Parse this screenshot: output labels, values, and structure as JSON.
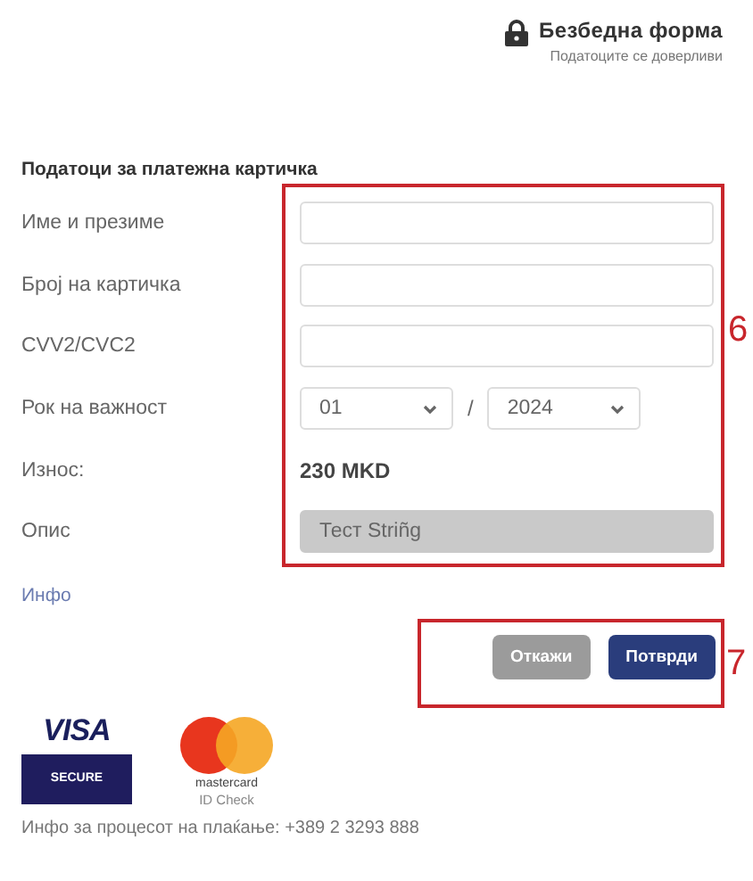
{
  "header": {
    "title": "Безбедна форма",
    "subtitle": "Податоците се доверливи"
  },
  "section_title": "Податоци за платежна картичка",
  "rows": [
    {
      "label": "Име и презиме",
      "kind": "input",
      "value": "",
      "disabled": false
    },
    {
      "label": "Број на картичка",
      "kind": "input",
      "value": "",
      "disabled": false
    },
    {
      "label": "CVV2/CVC2",
      "kind": "input",
      "value": "",
      "disabled": false
    },
    {
      "label": "Рок на важност",
      "kind": "expiry",
      "month": "01",
      "separator": "/",
      "year": "2024"
    },
    {
      "label": "Износ:",
      "kind": "amount",
      "value": "230 MKD"
    },
    {
      "label": "Опис",
      "kind": "input",
      "value": "Тест Striñg",
      "disabled": true
    }
  ],
  "info_link": "Инфо",
  "buttons": [
    {
      "label": "Откажи",
      "kind": "secondary"
    },
    {
      "label": "Потврди",
      "kind": "primary"
    }
  ],
  "logos": {
    "visa": {
      "brand": "VISA",
      "badge": "SECURE"
    },
    "mastercard": {
      "brand": "mastercard",
      "badge": "ID Check"
    }
  },
  "footer": "Инфо за процесот на плаќање: +389 2 3293 888",
  "annotations": [
    {
      "label": "6",
      "kind": "form"
    },
    {
      "label": "7",
      "kind": "buttons"
    }
  ]
}
